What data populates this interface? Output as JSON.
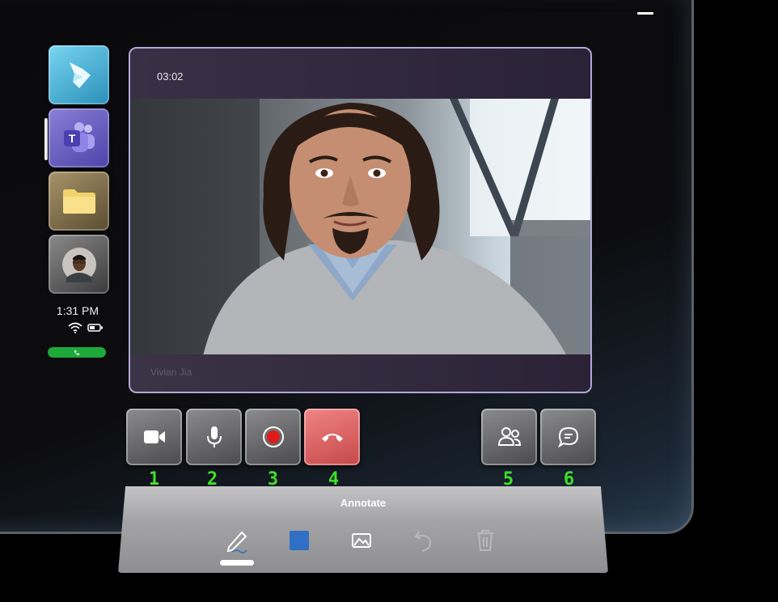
{
  "call": {
    "timer": "03:02",
    "caller_name": "Vivian Jia"
  },
  "sidebar": {
    "apps": [
      {
        "name": "Dynamics 365 Guides",
        "icon": "dynamics-icon"
      },
      {
        "name": "Microsoft Teams",
        "icon": "teams-icon",
        "badge": "T"
      },
      {
        "name": "Files",
        "icon": "folder-icon"
      },
      {
        "name": "Contact",
        "icon": "avatar-icon"
      }
    ],
    "time": "1:31 PM",
    "status_icons": [
      "wifi-icon",
      "battery-icon"
    ],
    "call_indicator_icon": "phone-icon"
  },
  "controls": [
    {
      "number": "1",
      "icon": "video-camera-icon"
    },
    {
      "number": "2",
      "icon": "microphone-icon"
    },
    {
      "number": "3",
      "icon": "record-icon"
    },
    {
      "number": "4",
      "icon": "end-call-icon"
    },
    {
      "number": "5",
      "icon": "participants-icon"
    },
    {
      "number": "6",
      "icon": "chat-icon"
    }
  ],
  "annotate": {
    "title": "Annotate",
    "tools": [
      "pen-icon",
      "color-swatch-icon",
      "image-icon",
      "undo-icon",
      "delete-icon"
    ],
    "selected_color": "#2f6fc4"
  },
  "colors": {
    "end_call": "#e06767",
    "call_active": "#1fa83a",
    "label_green": "#3ee02a",
    "record_red": "#e01b1b"
  }
}
